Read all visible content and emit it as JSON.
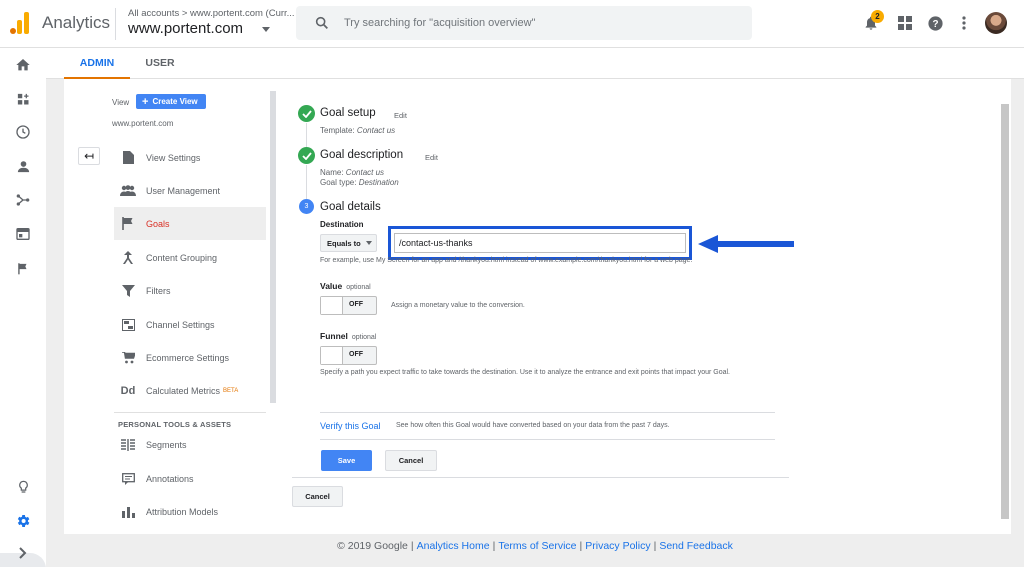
{
  "header": {
    "app_name": "Analytics",
    "account_breadcrumb": "All accounts > www.portent.com (Curr...",
    "account_name": "www.portent.com",
    "search_placeholder": "Try searching for \"acquisition overview\"",
    "notification_count": "2"
  },
  "tabs": [
    {
      "label": "ADMIN",
      "active": true
    },
    {
      "label": "USER",
      "active": false
    }
  ],
  "view_column": {
    "view_label": "View",
    "create_view_label": "Create View",
    "site_name": "www.portent.com",
    "items": [
      {
        "label": "View Settings",
        "icon": "document-icon"
      },
      {
        "label": "User Management",
        "icon": "users-icon"
      },
      {
        "label": "Goals",
        "icon": "flag-icon",
        "active": true
      },
      {
        "label": "Content Grouping",
        "icon": "grouping-icon"
      },
      {
        "label": "Filters",
        "icon": "filter-icon"
      },
      {
        "label": "Channel Settings",
        "icon": "channel-icon"
      },
      {
        "label": "Ecommerce Settings",
        "icon": "cart-icon"
      },
      {
        "label": "Calculated Metrics",
        "icon": "dd-icon",
        "badge": "BETA"
      }
    ],
    "section_title": "PERSONAL TOOLS & ASSETS",
    "tool_items": [
      {
        "label": "Segments",
        "icon": "segments-icon"
      },
      {
        "label": "Annotations",
        "icon": "annotation-icon"
      },
      {
        "label": "Attribution Models",
        "icon": "bar-chart-icon"
      }
    ]
  },
  "goal_setup": {
    "title": "Goal setup",
    "edit_label": "Edit",
    "template_label": "Template:",
    "template_value": "Contact us"
  },
  "goal_description": {
    "title": "Goal description",
    "edit_label": "Edit",
    "name_label": "Name:",
    "name_value": "Contact us",
    "type_label": "Goal type:",
    "type_value": "Destination"
  },
  "goal_details": {
    "step_number": "3",
    "title": "Goal details",
    "destination_label": "Destination",
    "match_type": "Equals to",
    "destination_value": "/contact-us-thanks",
    "destination_help": "For example, use My Screen for an app and /thankyou.html instead of www.example.com/thankyou.html for a web page.",
    "value_label": "Value",
    "value_optional": "optional",
    "value_toggle": "OFF",
    "value_desc": "Assign a monetary value to the conversion.",
    "funnel_label": "Funnel",
    "funnel_optional": "optional",
    "funnel_toggle": "OFF",
    "funnel_desc": "Specify a path you expect traffic to take towards the destination. Use it to analyze the entrance and exit points that impact your Goal.",
    "verify_label": "Verify this Goal",
    "verify_desc": "See how often this Goal would have converted based on your data from the past 7 days.",
    "save_label": "Save",
    "cancel_label": "Cancel"
  },
  "outer_cancel_label": "Cancel",
  "footer": {
    "copyright": "© 2019 Google",
    "links": [
      "Analytics Home",
      "Terms of Service",
      "Privacy Policy",
      "Send Feedback"
    ]
  },
  "colors": {
    "accent_blue": "#4285f4",
    "success_green": "#34a853",
    "highlight_blue": "#1a56d6",
    "active_red": "#d93025",
    "tab_underline": "#e37400"
  }
}
